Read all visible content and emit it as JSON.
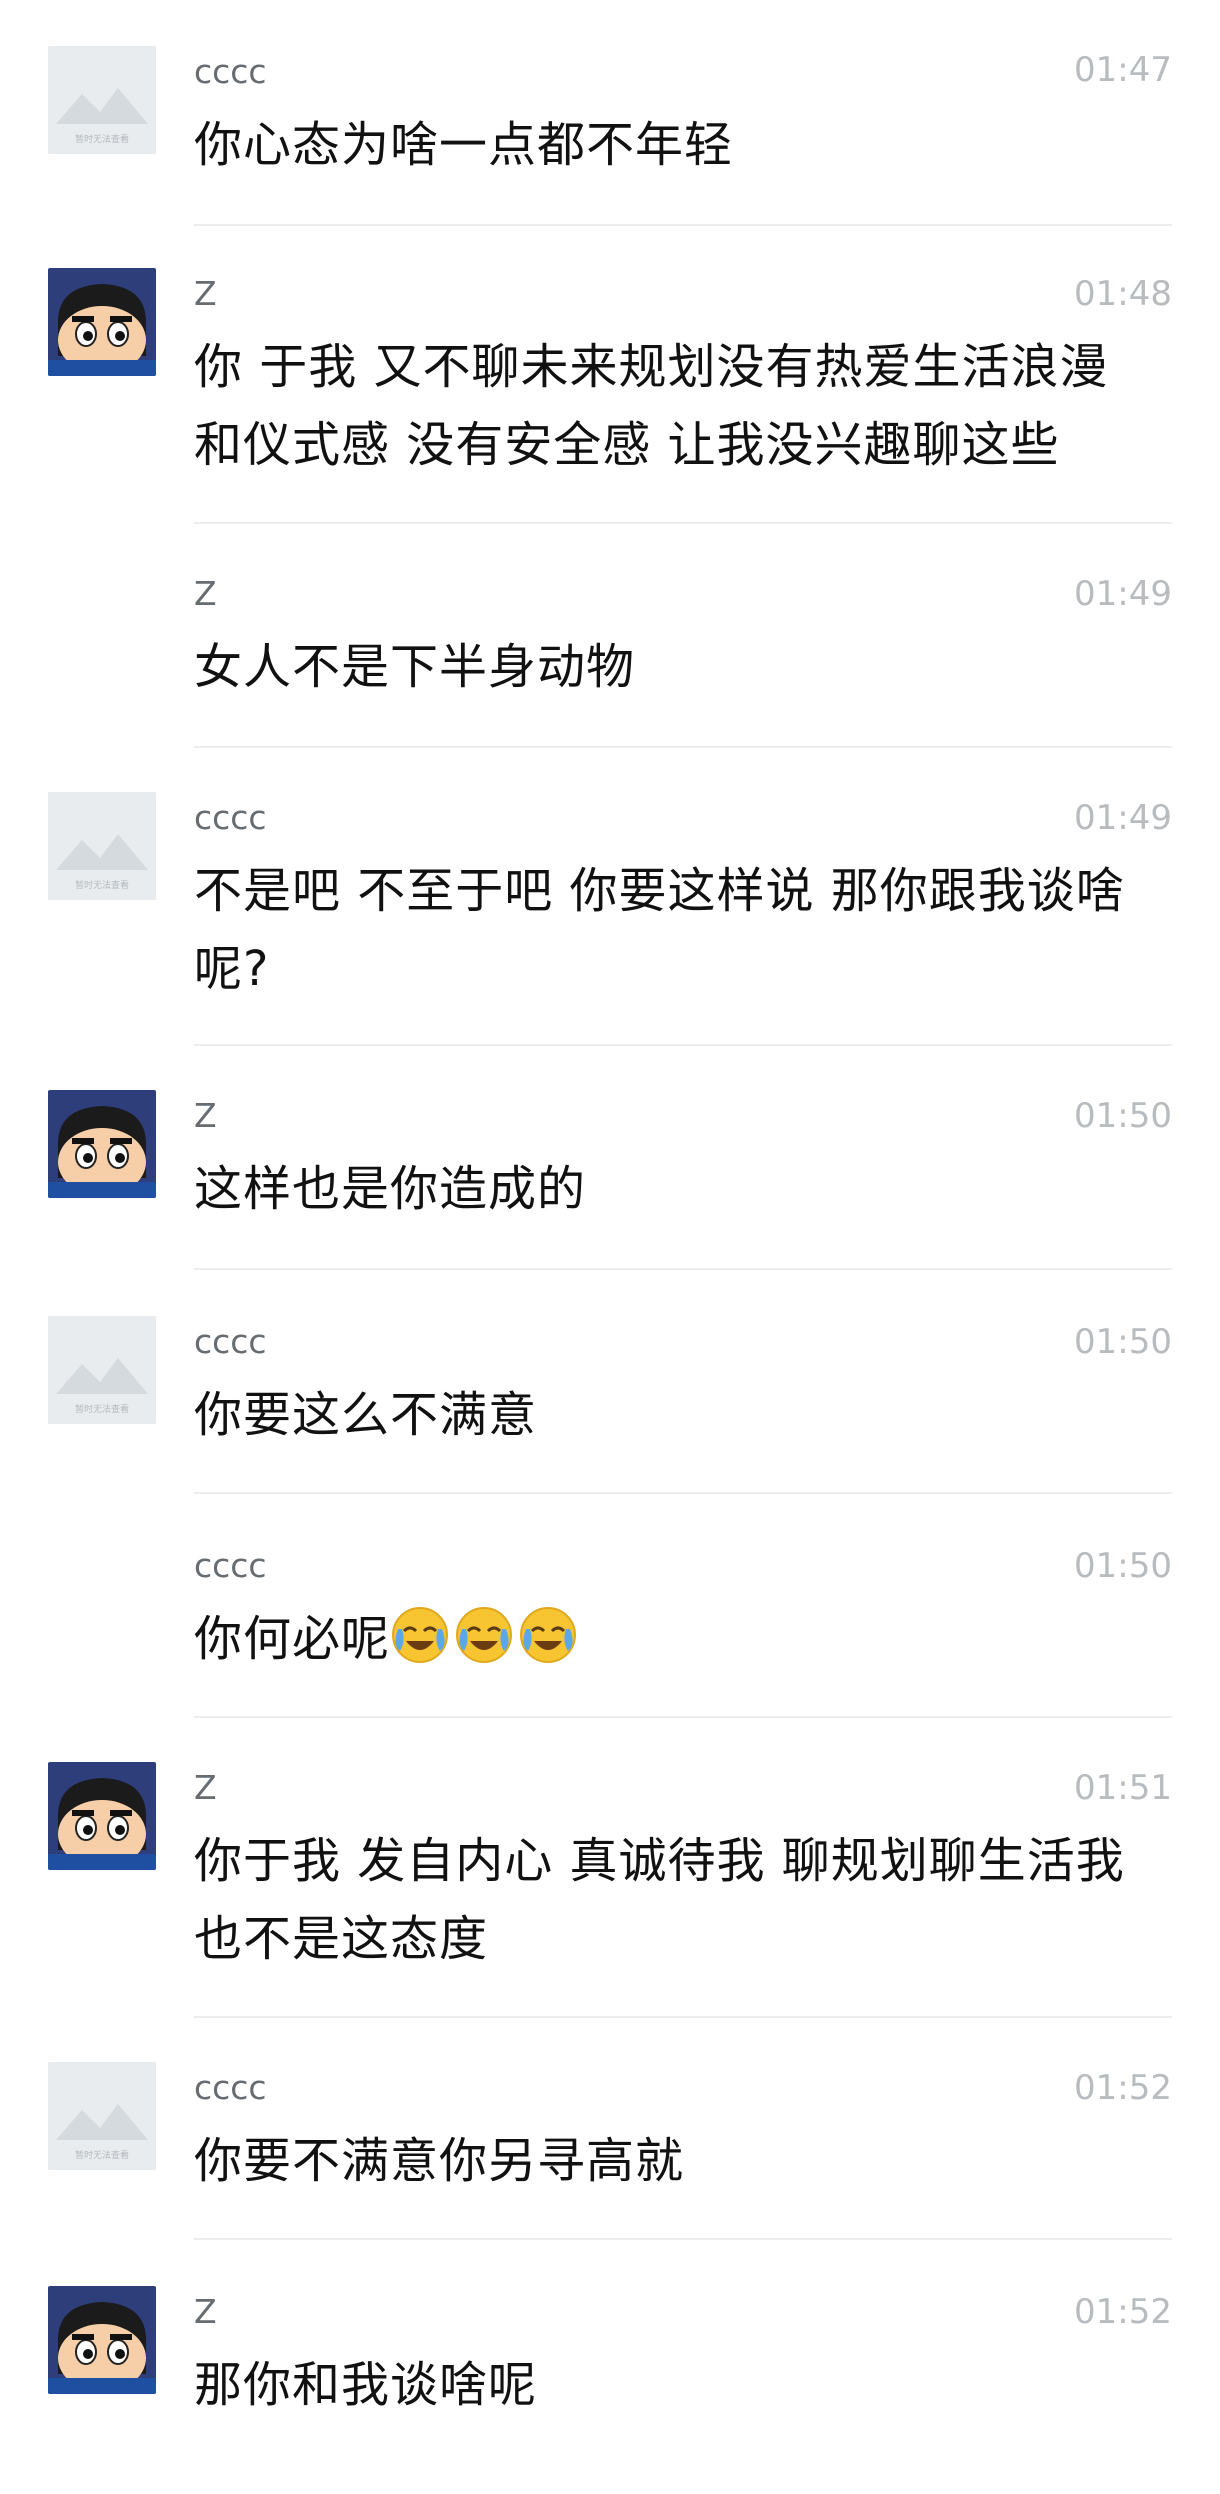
{
  "avatar_placeholder_text": "暂时无法查看",
  "messages": [
    {
      "sender": "cccc",
      "time": "01:47",
      "text": "你心态为啥一点都不年轻",
      "avatar": "placeholder-image-icon"
    },
    {
      "sender": "Z",
      "time": "01:48",
      "text": "你 于我 又不聊未来规划没有热爱生活浪漫和仪式感 没有安全感 让我没兴趣聊这些",
      "avatar": "crayon-shinchan-avatar"
    },
    {
      "sender": "Z",
      "time": "01:49",
      "text": "女人不是下半身动物",
      "avatar": "none"
    },
    {
      "sender": "cccc",
      "time": "01:49",
      "text": "不是吧 不至于吧 你要这样说 那你跟我谈啥呢?",
      "avatar": "placeholder-image-icon"
    },
    {
      "sender": "Z",
      "time": "01:50",
      "text": "这样也是你造成的",
      "avatar": "crayon-shinchan-avatar"
    },
    {
      "sender": "cccc",
      "time": "01:50",
      "text": "你要这么不满意",
      "avatar": "placeholder-image-icon"
    },
    {
      "sender": "cccc",
      "time": "01:50",
      "text": "你何必呢",
      "avatar": "none",
      "emoji": [
        "crying-laughing-emoji",
        "crying-laughing-emoji",
        "crying-laughing-emoji"
      ]
    },
    {
      "sender": "Z",
      "time": "01:51",
      "text": "你于我 发自内心 真诚待我 聊规划聊生活我也不是这态度",
      "avatar": "crayon-shinchan-avatar"
    },
    {
      "sender": "cccc",
      "time": "01:52",
      "text": "你要不满意你另寻高就",
      "avatar": "placeholder-image-icon"
    },
    {
      "sender": "Z",
      "time": "01:52",
      "text": "那你和我谈啥呢",
      "avatar": "crayon-shinchan-avatar"
    }
  ]
}
